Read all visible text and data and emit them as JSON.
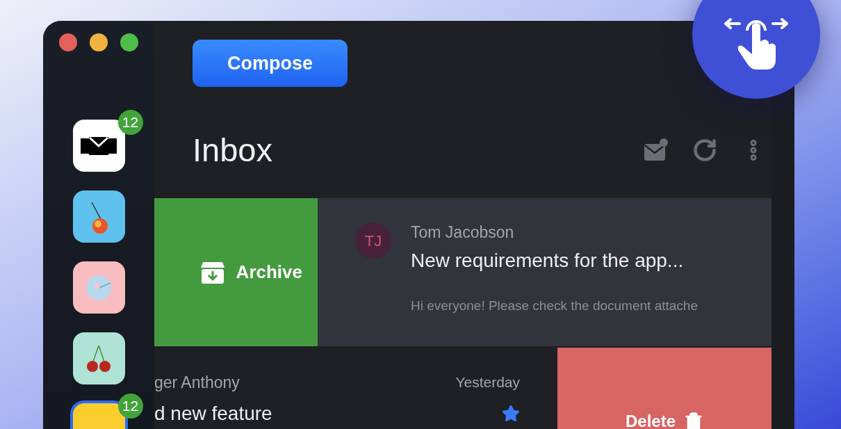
{
  "sidebar": {
    "apps": [
      {
        "kind": "mail",
        "badge": "12",
        "selected": false
      },
      {
        "kind": "orange",
        "selected": false
      },
      {
        "kind": "disc",
        "selected": false
      },
      {
        "kind": "cherries",
        "selected": false
      },
      {
        "kind": "yellow",
        "badge": "12",
        "selected": true
      }
    ]
  },
  "compose_button": "Compose",
  "title": "Inbox",
  "messages": [
    {
      "kind": "archive",
      "action_label": "Archive",
      "initials": "TJ",
      "sender": "Tom Jacobson",
      "subject": "New requirements for the app...",
      "preview": "Hi everyone! Please check the document attache"
    },
    {
      "kind": "delete",
      "action_label": "Delete",
      "sender": "ger Anthony",
      "subject": "d new feature",
      "time": "Yesterday",
      "starred": true
    }
  ]
}
